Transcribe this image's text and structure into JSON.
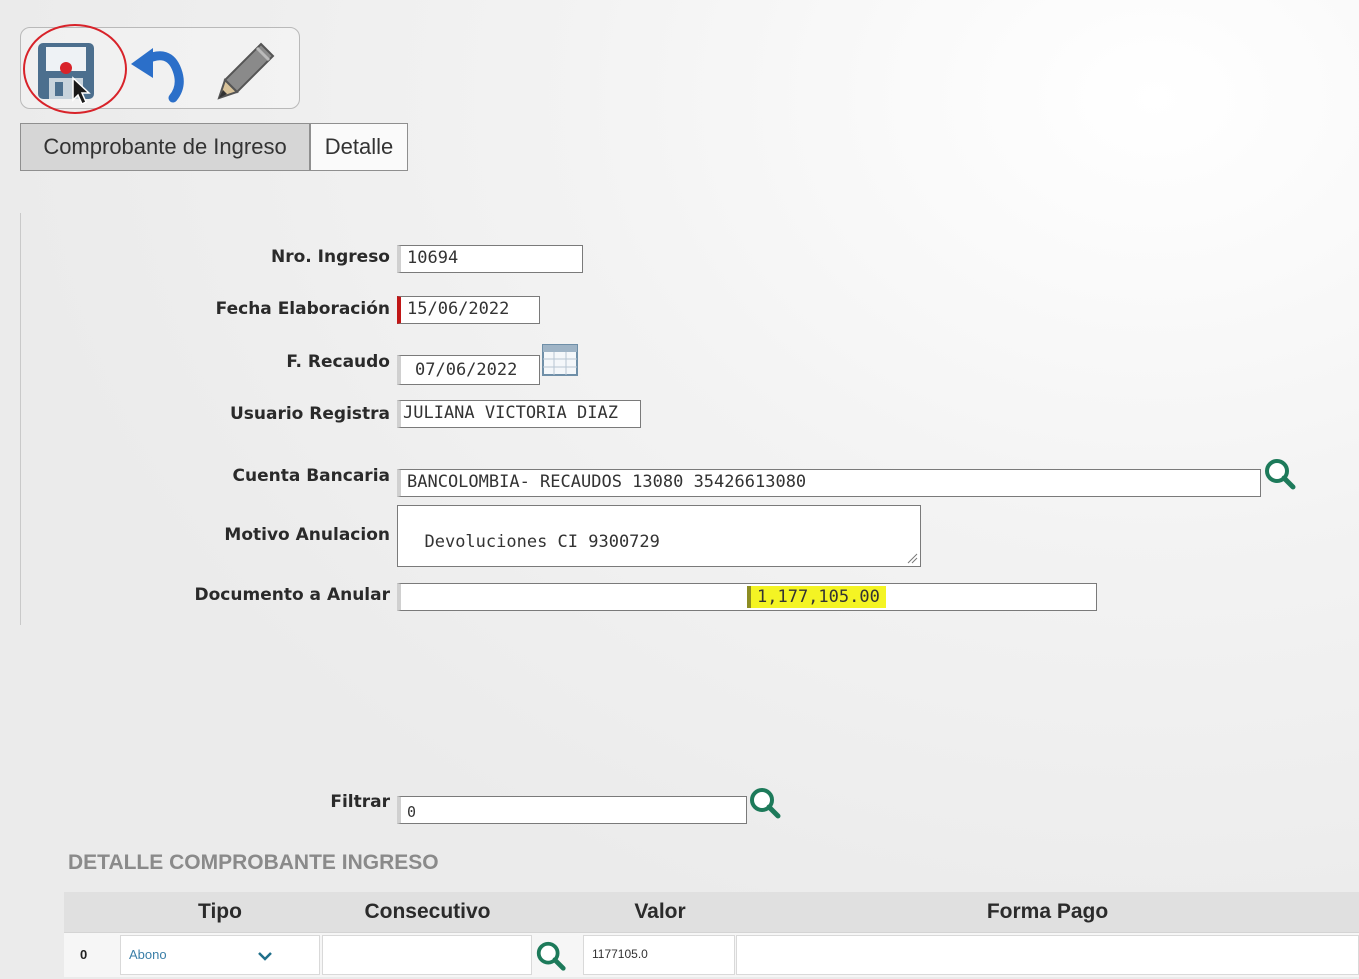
{
  "toolbar": {
    "save_icon": "floppy-disk-icon",
    "undo_icon": "undo-arrow-icon",
    "edit_icon": "pencil-icon"
  },
  "tabs": [
    {
      "label": "Comprobante de Ingreso",
      "active": true
    },
    {
      "label": "Detalle",
      "active": false
    }
  ],
  "form": {
    "nro_ingreso": {
      "label": "Nro. Ingreso",
      "value": "10694"
    },
    "fecha_elaboracion": {
      "label": "Fecha Elaboración",
      "value": "15/06/2022"
    },
    "f_recaudo": {
      "label": "F. Recaudo",
      "value": "07/06/2022"
    },
    "usuario_registra": {
      "label": "Usuario Registra",
      "value": "JULIANA VICTORIA DIAZ"
    },
    "cuenta_bancaria": {
      "label": "Cuenta Bancaria",
      "value": "BANCOLOMBIA- RECAUDOS 13080 35426613080"
    },
    "motivo_anulacion": {
      "label": "Motivo Anulacion",
      "value": "Devoluciones CI 9300729"
    },
    "documento_anular": {
      "label": "Documento a Anular",
      "value": "",
      "amount": "1,177,105.00"
    },
    "filtrar": {
      "label": "Filtrar",
      "value": "0"
    }
  },
  "detail": {
    "title": "DETALLE COMPROBANTE INGRESO",
    "columns": [
      "Tipo",
      "Consecutivo",
      "Valor",
      "Forma Pago"
    ],
    "rows": [
      {
        "index": "0",
        "tipo": "Abono",
        "consecutivo": "",
        "valor": "1177105.0",
        "forma_pago": ""
      }
    ]
  },
  "colors": {
    "required_marker": "#c01616",
    "highlight": "#f4f424",
    "search_icon": "#1d7a5a",
    "circle": "#d8232a"
  }
}
